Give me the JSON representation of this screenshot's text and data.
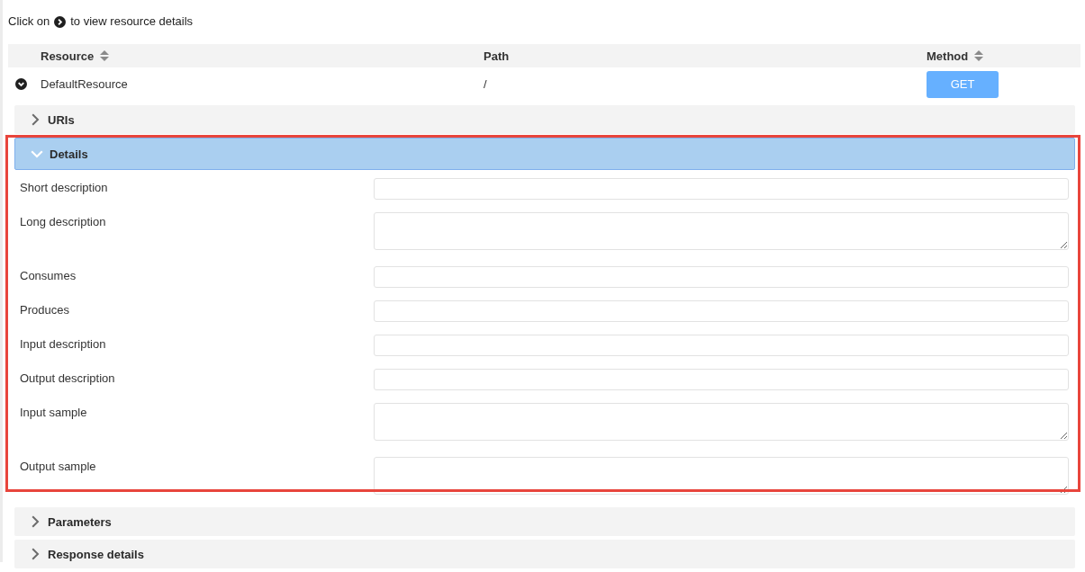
{
  "intro": {
    "before": "Click on",
    "after": "to view resource details"
  },
  "table": {
    "columns": [
      {
        "label": "Resource",
        "sortable": true
      },
      {
        "label": "Path",
        "sortable": false
      },
      {
        "label": "Method",
        "sortable": true
      }
    ],
    "rows": [
      {
        "resource": "DefaultResource",
        "path": "/",
        "method": "GET",
        "expanded": true,
        "sections": [
          {
            "title": "URIs",
            "expanded": false,
            "highlighted": false
          },
          {
            "title": "Details",
            "expanded": true,
            "highlighted": true,
            "fields": [
              {
                "label": "Short description",
                "kind": "input"
              },
              {
                "label": "Long description",
                "kind": "textarea"
              },
              {
                "label": "Consumes",
                "kind": "input"
              },
              {
                "label": "Produces",
                "kind": "input"
              },
              {
                "label": "Input description",
                "kind": "input"
              },
              {
                "label": "Output description",
                "kind": "input"
              },
              {
                "label": "Input sample",
                "kind": "textarea"
              },
              {
                "label": "Output sample",
                "kind": "textarea"
              }
            ]
          },
          {
            "title": "Parameters",
            "expanded": false,
            "highlighted": false
          },
          {
            "title": "Response details",
            "expanded": false,
            "highlighted": false
          }
        ]
      }
    ]
  }
}
